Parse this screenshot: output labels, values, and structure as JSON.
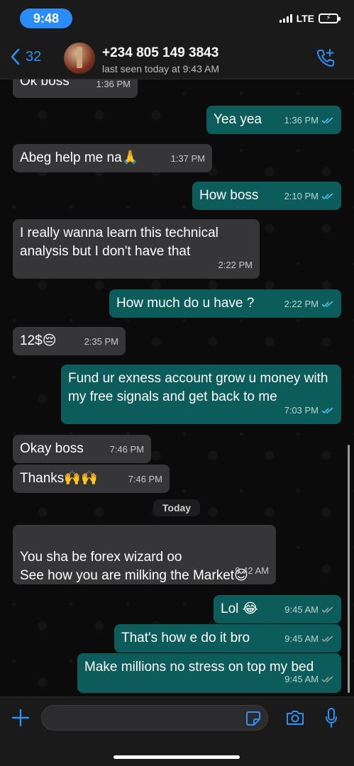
{
  "status_bar": {
    "time": "9:48",
    "network": "LTE",
    "battery_icon": "battery-charging-icon"
  },
  "header": {
    "back_count": "32",
    "contact_name": "+234 805 149 3843",
    "last_seen": "last seen today at 9:43 AM",
    "accent": "#2f8ff2"
  },
  "messages": [
    {
      "text": "Ok boss",
      "time": "1:36 PM",
      "dir": "in"
    },
    {
      "text": "Yea yea",
      "time": "1:36 PM",
      "dir": "out"
    },
    {
      "text": "Abeg help me na🙏",
      "time": "1:37 PM",
      "dir": "in"
    },
    {
      "text": "How boss",
      "time": "2:10 PM",
      "dir": "out"
    },
    {
      "text": "I really wanna learn this technical analysis but I don't have that",
      "time": "2:22 PM",
      "dir": "in"
    },
    {
      "text": "How much do u have ?",
      "time": "2:22 PM",
      "dir": "out"
    },
    {
      "text": "12$😔",
      "time": "2:35 PM",
      "dir": "in"
    },
    {
      "text": "Fund ur exness account grow u money with my free signals and get back to me",
      "time": "7:03 PM",
      "dir": "out"
    },
    {
      "text": "Okay boss",
      "time": "7:46 PM",
      "dir": "in"
    },
    {
      "text": "Thanks🙌🙌",
      "time": "7:46 PM",
      "dir": "in"
    },
    {
      "text": "You sha be forex wizard oo\nSee how you are milking the Market😊",
      "time": "9:42 AM",
      "dir": "in"
    },
    {
      "text": "Lol 😂",
      "time": "9:45 AM",
      "dir": "out"
    },
    {
      "text": "That's how e do it bro",
      "time": "9:45 AM",
      "dir": "out"
    },
    {
      "text": "Make millions no stress on top my bed",
      "time": "9:45 AM",
      "dir": "out"
    }
  ],
  "day_separator": "Today",
  "input": {
    "placeholder": ""
  },
  "colors": {
    "incoming": "#363638",
    "outgoing": "#0b5c5a",
    "read_ticks": "#53bdeb",
    "delivered_ticks": "#9aa0a6"
  }
}
